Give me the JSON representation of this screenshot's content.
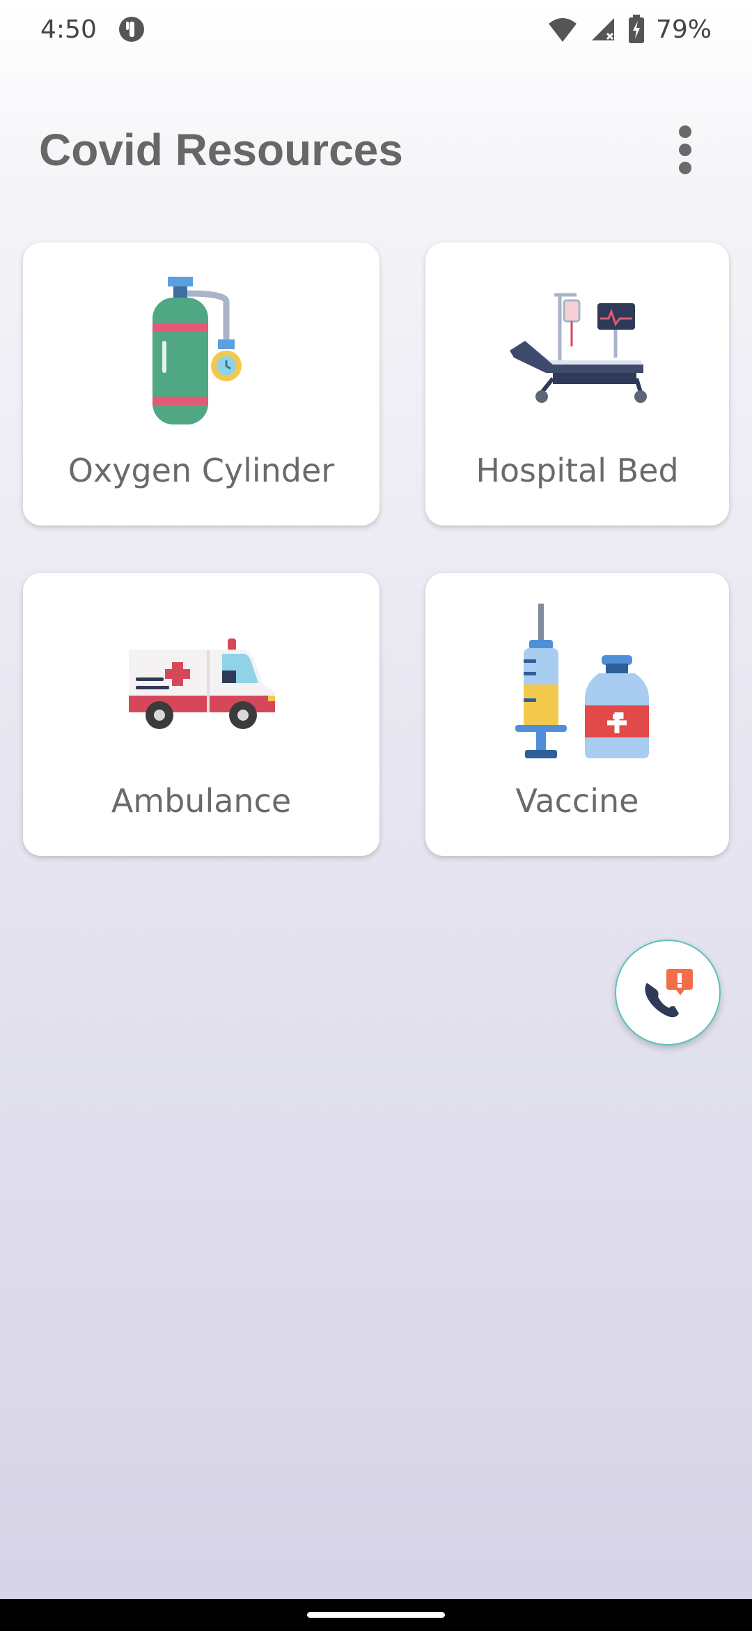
{
  "status_bar": {
    "time": "4:50",
    "battery": "79%",
    "icons": [
      "data-saver-icon",
      "wifi-icon",
      "cell-signal-icon",
      "battery-charging-icon"
    ]
  },
  "app_bar": {
    "title": "Covid Resources",
    "menu_icon": "more-vertical-icon"
  },
  "resources": [
    {
      "label": "Oxygen Cylinder",
      "icon": "oxygen-cylinder-icon"
    },
    {
      "label": "Hospital Bed",
      "icon": "hospital-bed-icon"
    },
    {
      "label": "Ambulance",
      "icon": "ambulance-icon"
    },
    {
      "label": "Vaccine",
      "icon": "vaccine-icon"
    }
  ],
  "fab": {
    "icon": "emergency-call-icon"
  },
  "colors": {
    "card_bg": "#ffffff",
    "title": "#676767",
    "fab_border": "#5ac2b8"
  }
}
